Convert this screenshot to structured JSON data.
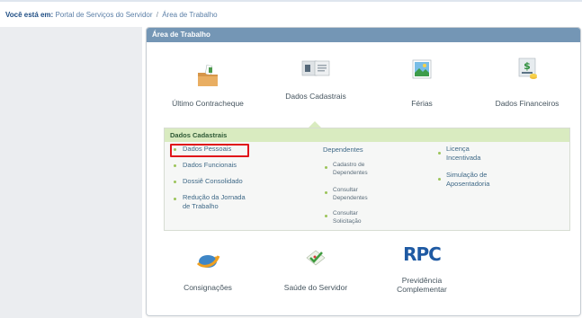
{
  "breadcrumb": {
    "title": "Você está em:",
    "link1": "Portal de Serviços do Servidor",
    "separator": "/",
    "link2": "Área de Trabalho"
  },
  "panel": {
    "title": "Área de Trabalho"
  },
  "tiles_top": [
    {
      "label": "Último Contracheque",
      "icon": "folder-document-icon"
    },
    {
      "label": "Dados Cadastrais",
      "icon": "id-cards-icon"
    },
    {
      "label": "Férias",
      "icon": "vacation-picture-icon"
    },
    {
      "label": "Dados Financeiros",
      "icon": "money-coins-icon"
    }
  ],
  "submenu": {
    "title": "Dados Cadastrais",
    "col1": [
      "Dados Pessoais",
      "Dados Funcionais",
      "Dossiê Consolidado",
      "Redução da Jornada de Trabalho"
    ],
    "col2": {
      "heading": "Dependentes",
      "items": [
        "Cadastro de Dependentes",
        "Consultar Dependentes",
        "Consultar Solicitação"
      ]
    },
    "col3": [
      "Licença Incentivada",
      "Simulação de Aposentadoria"
    ]
  },
  "tiles_bottom": [
    {
      "label": "Consignações",
      "icon": "globe-arrow-icon"
    },
    {
      "label": "Saúde do Servidor",
      "icon": "medical-check-icon"
    },
    {
      "label": "Previdência Complementar",
      "icon": "rpc-logo-icon",
      "logo_text": "RPC"
    }
  ],
  "colors": {
    "header_blue": "#7496b5",
    "submenu_green": "#d9ebc0",
    "highlight_red": "#e0141a",
    "link_blue": "#3f6987"
  }
}
